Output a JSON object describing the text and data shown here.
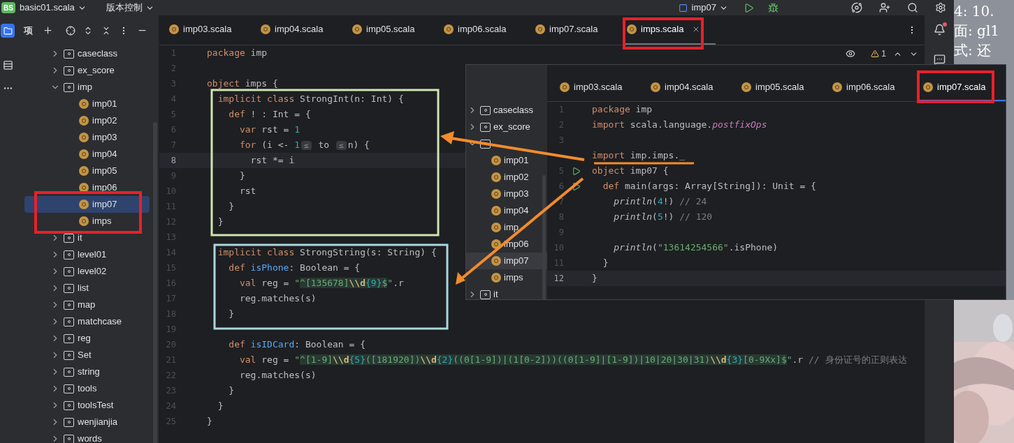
{
  "title_bar": {
    "project_badge": "BS",
    "project": "basic01.scala",
    "vcs": "版本控制",
    "run_config": "imp07"
  },
  "project_panel": {
    "title": "项",
    "tree": [
      {
        "label": "caseclass",
        "kind": "folder",
        "expanded": false,
        "selected": false
      },
      {
        "label": "ex_score",
        "kind": "folder",
        "expanded": false,
        "selected": false
      },
      {
        "label": "imp",
        "kind": "folder",
        "expanded": true,
        "selected": false,
        "children": [
          {
            "label": "imp01",
            "kind": "file",
            "selected": false
          },
          {
            "label": "imp02",
            "kind": "file",
            "selected": false
          },
          {
            "label": "imp03",
            "kind": "file",
            "selected": false
          },
          {
            "label": "imp04",
            "kind": "file",
            "selected": false
          },
          {
            "label": "imp05",
            "kind": "file",
            "selected": false
          },
          {
            "label": "imp06",
            "kind": "file",
            "selected": false
          },
          {
            "label": "imp07",
            "kind": "file",
            "selected": true
          },
          {
            "label": "imps",
            "kind": "file",
            "selected": false
          }
        ]
      },
      {
        "label": "it",
        "kind": "folder",
        "expanded": false,
        "selected": false
      },
      {
        "label": "level01",
        "kind": "folder",
        "expanded": false,
        "selected": false
      },
      {
        "label": "level02",
        "kind": "folder",
        "expanded": false,
        "selected": false
      },
      {
        "label": "list",
        "kind": "folder",
        "expanded": false,
        "selected": false
      },
      {
        "label": "map",
        "kind": "folder",
        "expanded": false,
        "selected": false
      },
      {
        "label": "matchcase",
        "kind": "folder",
        "expanded": false,
        "selected": false
      },
      {
        "label": "reg",
        "kind": "folder",
        "expanded": false,
        "selected": false
      },
      {
        "label": "Set",
        "kind": "folder",
        "expanded": false,
        "selected": false
      },
      {
        "label": "string",
        "kind": "folder",
        "expanded": false,
        "selected": false
      },
      {
        "label": "tools",
        "kind": "folder",
        "expanded": false,
        "selected": false
      },
      {
        "label": "toolsTest",
        "kind": "folder",
        "expanded": false,
        "selected": false
      },
      {
        "label": "wenjianjia",
        "kind": "folder",
        "expanded": false,
        "selected": false
      },
      {
        "label": "words",
        "kind": "folder",
        "expanded": false,
        "selected": false
      }
    ]
  },
  "editor": {
    "tabs": [
      {
        "label": "imp03.scala",
        "selected": false
      },
      {
        "label": "imp04.scala",
        "selected": false
      },
      {
        "label": "imp05.scala",
        "selected": false
      },
      {
        "label": "imp06.scala",
        "selected": false
      },
      {
        "label": "imp07.scala",
        "selected": false
      },
      {
        "label": "imps.scala",
        "selected": true
      }
    ],
    "problems": "1",
    "lines": [
      {
        "n": "1",
        "current": false,
        "tokens": [
          {
            "kind": "kw",
            "text": "package"
          },
          {
            "kind": "pl",
            "text": " imp"
          }
        ]
      },
      {
        "n": "2",
        "current": false
      },
      {
        "n": "3",
        "current": false,
        "tokens": [
          {
            "kind": "kw",
            "text": "object"
          },
          {
            "kind": "pl",
            "text": " imps {"
          }
        ]
      },
      {
        "n": "4",
        "current": false,
        "tokens": [
          {
            "kind": "kw",
            "text": "  implicit class"
          },
          {
            "kind": "pl",
            "text": " StrongInt(n: Int) {"
          }
        ]
      },
      {
        "n": "5",
        "current": false,
        "tokens": [
          {
            "kind": "kw",
            "text": "    def"
          },
          {
            "kind": "pl",
            "text": " ! : Int = {"
          }
        ]
      },
      {
        "n": "6",
        "current": false,
        "tokens": [
          {
            "kind": "kw",
            "text": "      var"
          },
          {
            "kind": "pl",
            "text": " rst = "
          },
          {
            "kind": "num",
            "text": "1"
          }
        ]
      },
      {
        "n": "7",
        "current": false,
        "tokens": [
          {
            "kind": "kw",
            "text": "      for"
          },
          {
            "kind": "pl",
            "text": " (i <- "
          },
          {
            "kind": "num",
            "text": "1"
          },
          {
            "kind": "hint",
            "text": "≤"
          },
          {
            "kind": "pl",
            "text": " to "
          },
          {
            "kind": "hint",
            "text": "≤"
          },
          {
            "kind": "pl",
            "text": "n) {"
          }
        ]
      },
      {
        "n": "8",
        "current": true,
        "tokens": [
          {
            "kind": "pl",
            "text": "        rst *= i"
          }
        ]
      },
      {
        "n": "9",
        "current": false,
        "tokens": [
          {
            "kind": "pl",
            "text": "      }"
          }
        ]
      },
      {
        "n": "10",
        "current": false,
        "tokens": [
          {
            "kind": "pl",
            "text": "      rst"
          }
        ]
      },
      {
        "n": "11",
        "current": false,
        "tokens": [
          {
            "kind": "pl",
            "text": "    }"
          }
        ]
      },
      {
        "n": "12",
        "current": false,
        "tokens": [
          {
            "kind": "pl",
            "text": "  }"
          }
        ]
      },
      {
        "n": "13",
        "current": false
      },
      {
        "n": "14",
        "current": false,
        "tokens": [
          {
            "kind": "kw",
            "text": "  implicit class"
          },
          {
            "kind": "pl",
            "text": " StrongString(s: String) {"
          }
        ]
      },
      {
        "n": "15",
        "current": false,
        "tokens": [
          {
            "kind": "kw",
            "text": "    def"
          },
          {
            "kind": "fn",
            "text": " isPhone"
          },
          {
            "kind": "pl",
            "text": ": Boolean = {"
          }
        ]
      },
      {
        "n": "16",
        "current": false,
        "tokens": [
          {
            "kind": "kw",
            "text": "      val"
          },
          {
            "kind": "pl",
            "text": " reg = "
          },
          {
            "kind": "str",
            "text": "\""
          },
          {
            "kind": "rx",
            "text": "^[135678]"
          },
          {
            "kind": "esc",
            "text": "\\\\d"
          },
          {
            "kind": "rxn",
            "text": "{9}"
          },
          {
            "kind": "rx",
            "text": "$"
          },
          {
            "kind": "str",
            "text": "\""
          },
          {
            "kind": "pl",
            "text": ".r"
          }
        ]
      },
      {
        "n": "17",
        "current": false,
        "tokens": [
          {
            "kind": "pl",
            "text": "      reg.matches(s)"
          }
        ]
      },
      {
        "n": "18",
        "current": false,
        "tokens": [
          {
            "kind": "pl",
            "text": "    }"
          }
        ]
      },
      {
        "n": "19",
        "current": false
      },
      {
        "n": "20",
        "current": false,
        "tokens": [
          {
            "kind": "kw",
            "text": "    def"
          },
          {
            "kind": "fn",
            "text": " isIDCard"
          },
          {
            "kind": "pl",
            "text": ": Boolean = {"
          }
        ]
      },
      {
        "n": "21",
        "current": false,
        "tokens": [
          {
            "kind": "kw",
            "text": "      val"
          },
          {
            "kind": "pl",
            "text": " reg = "
          },
          {
            "kind": "str",
            "text": "\""
          },
          {
            "kind": "rx",
            "text": "^[1-9]"
          },
          {
            "kind": "esc",
            "text": "\\\\d"
          },
          {
            "kind": "rxn",
            "text": "{5}"
          },
          {
            "kind": "rx",
            "text": "([181920])"
          },
          {
            "kind": "esc",
            "text": "\\\\d"
          },
          {
            "kind": "rxn",
            "text": "{2}"
          },
          {
            "kind": "rx",
            "text": "((0[1-9])|(1[0-2]))((0[1-9]|[1-9])|10|20|30|31)"
          },
          {
            "kind": "esc",
            "text": "\\\\d"
          },
          {
            "kind": "rxn",
            "text": "{3}"
          },
          {
            "kind": "rx",
            "text": "[0-9Xx]$"
          },
          {
            "kind": "str",
            "text": "\""
          },
          {
            "kind": "pl",
            "text": ".r "
          },
          {
            "kind": "cm",
            "text": "// 身份证号的正则表达"
          }
        ]
      },
      {
        "n": "22",
        "current": false,
        "tokens": [
          {
            "kind": "pl",
            "text": "      reg.matches(s)"
          }
        ]
      },
      {
        "n": "23",
        "current": false,
        "tokens": [
          {
            "kind": "pl",
            "text": "    }"
          }
        ]
      },
      {
        "n": "24",
        "current": false,
        "tokens": [
          {
            "kind": "pl",
            "text": "  }"
          }
        ]
      },
      {
        "n": "25",
        "current": false,
        "tokens": [
          {
            "kind": "pl",
            "text": "}"
          }
        ]
      }
    ]
  },
  "screenshot_overlay": {
    "tree": [
      {
        "label": "caseclass",
        "kind": "folder",
        "expanded": false,
        "selected": false
      },
      {
        "label": "ex_score",
        "kind": "folder",
        "expanded": false,
        "selected": false
      },
      {
        "kind": "folder",
        "expanded": true,
        "selected": false,
        "children": [
          {
            "label": "imp01",
            "kind": "file",
            "selected": false
          },
          {
            "label": "imp02",
            "kind": "file",
            "selected": false
          },
          {
            "label": "imp03",
            "kind": "file",
            "selected": false
          },
          {
            "label": "imp04",
            "kind": "file",
            "selected": false
          },
          {
            "label": "imp",
            "kind": "file",
            "selected": false
          },
          {
            "label": "imp06",
            "kind": "file",
            "selected": false
          },
          {
            "label": "imp07",
            "kind": "file",
            "selected": true
          },
          {
            "label": "imps",
            "kind": "file",
            "selected": false
          }
        ]
      },
      {
        "label": "it",
        "kind": "folder",
        "expanded": false,
        "selected": false
      }
    ],
    "tabs": [
      {
        "label": "imp03.scala",
        "selected": false
      },
      {
        "label": "imp04.scala",
        "selected": false
      },
      {
        "label": "imp05.scala",
        "selected": false
      },
      {
        "label": "imp06.scala",
        "selected": false
      },
      {
        "label": "imp07.scala",
        "selected": true
      }
    ],
    "lines": [
      {
        "n": "1",
        "current": false,
        "runnable": false,
        "tokens": [
          {
            "kind": "kw",
            "text": "package"
          },
          {
            "kind": "pl",
            "text": " imp"
          }
        ]
      },
      {
        "n": "2",
        "current": false,
        "runnable": false,
        "tokens": [
          {
            "kind": "kw",
            "text": "import"
          },
          {
            "kind": "pl",
            "text": " scala.language."
          },
          {
            "kind": "ital",
            "text": "postfixOps"
          }
        ]
      },
      {
        "n": "3",
        "current": false,
        "runnable": false
      },
      {
        "current": false,
        "runnable": false,
        "tokens": [
          {
            "kind": "kw",
            "text": "import"
          },
          {
            "kind": "pl",
            "text": " imp.imps._"
          }
        ]
      },
      {
        "n": "5",
        "current": false,
        "runnable": true,
        "tokens": [
          {
            "kind": "kw",
            "text": "object"
          },
          {
            "kind": "pl",
            "text": " imp07 {"
          }
        ]
      },
      {
        "n": "6",
        "current": false,
        "runnable": true,
        "tokens": [
          {
            "kind": "kw",
            "text": "  def"
          },
          {
            "kind": "pl",
            "text": " main(args: Array[String]): Unit = {"
          }
        ]
      },
      {
        "n": "7",
        "current": false,
        "runnable": false,
        "tokens": [
          {
            "kind": "call",
            "text": "    println"
          },
          {
            "kind": "pl",
            "text": "("
          },
          {
            "kind": "num",
            "text": "4"
          },
          {
            "kind": "pl",
            "text": "!) "
          },
          {
            "kind": "cm",
            "text": "// 24"
          }
        ]
      },
      {
        "n": "8",
        "current": false,
        "runnable": false,
        "tokens": [
          {
            "kind": "call",
            "text": "    println"
          },
          {
            "kind": "pl",
            "text": "("
          },
          {
            "kind": "num",
            "text": "5"
          },
          {
            "kind": "pl",
            "text": "!) "
          },
          {
            "kind": "cm",
            "text": "// 120"
          }
        ]
      },
      {
        "n": "9",
        "current": false,
        "runnable": false
      },
      {
        "n": "10",
        "current": false,
        "runnable": false,
        "tokens": [
          {
            "kind": "call",
            "text": "    println"
          },
          {
            "kind": "pl",
            "text": "("
          },
          {
            "kind": "str",
            "text": "\"13614254566\""
          },
          {
            "kind": "pl",
            "text": ".isPhone)"
          }
        ]
      },
      {
        "n": "11",
        "current": false,
        "runnable": false,
        "tokens": [
          {
            "kind": "pl",
            "text": "  }"
          }
        ]
      },
      {
        "n": "12",
        "current": true,
        "runnable": false,
        "tokens": [
          {
            "kind": "pl",
            "text": "}"
          }
        ]
      }
    ]
  },
  "background_window": {
    "lines": [
      "4: 10.",
      "面: gl1",
      "式: 还"
    ]
  }
}
